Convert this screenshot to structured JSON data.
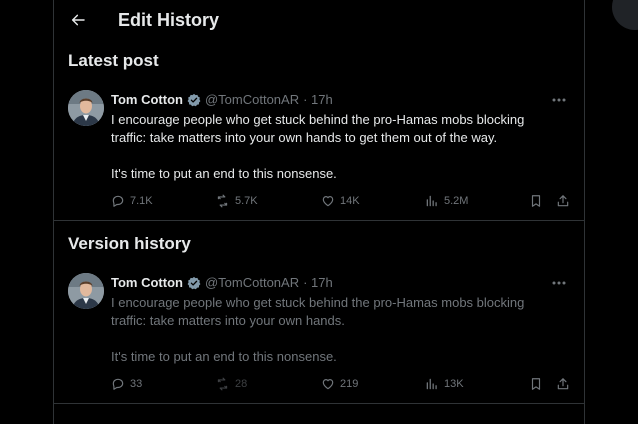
{
  "header": {
    "title": "Edit History"
  },
  "latest": {
    "section_title": "Latest post",
    "author": "Tom Cotton",
    "handle": "@TomCottonAR",
    "time": "· 17h",
    "paragraph1": "I encourage people who get stuck behind the pro-Hamas mobs blocking traffic: take matters into your own hands to get them out of the way.",
    "paragraph2": "It's time to put an end to this nonsense.",
    "replies": "7.1K",
    "reposts": "5.7K",
    "likes": "14K",
    "views": "5.2M"
  },
  "history": {
    "section_title": "Version history",
    "author": "Tom Cotton",
    "handle": "@TomCottonAR",
    "time": "· 17h",
    "paragraph1": "I encourage people who get stuck behind the pro-Hamas mobs blocking traffic: take matters into your own hands.",
    "paragraph2": "It's time to put an end to this nonsense.",
    "replies": "33",
    "reposts": "28",
    "likes": "219",
    "views": "13K"
  },
  "colors": {
    "background": "#000000",
    "text_primary": "#e7e9ea",
    "text_secondary": "#71767b",
    "border": "#2f3336",
    "verified": "#829aab"
  },
  "icons": {
    "back": "arrow-left-icon",
    "verified": "verified-badge-icon",
    "more": "more-horizontal-icon",
    "reply": "reply-icon",
    "repost": "repost-icon",
    "like": "heart-icon",
    "views": "views-chart-icon",
    "bookmark": "bookmark-icon",
    "share": "share-icon"
  }
}
